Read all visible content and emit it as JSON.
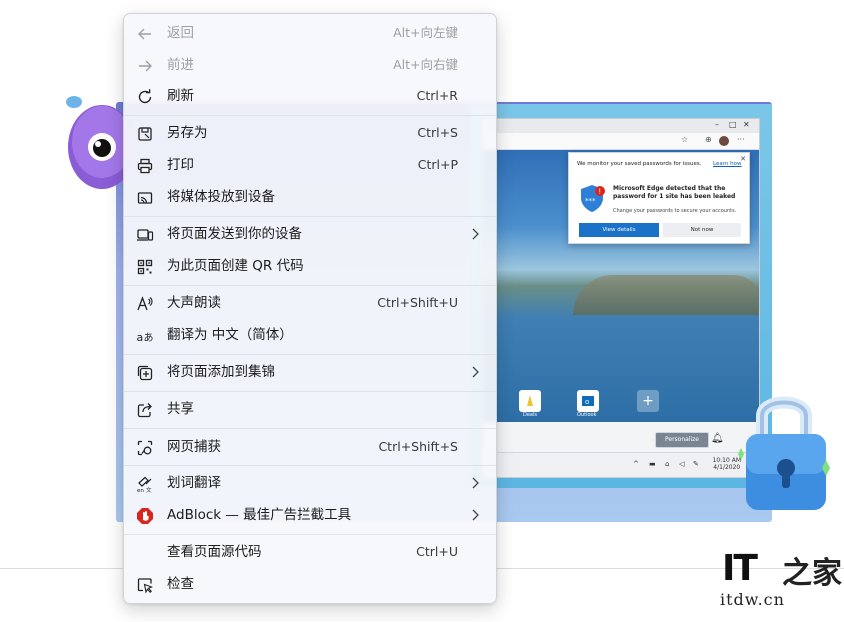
{
  "menu": {
    "back": {
      "label": "返回",
      "shortcut": "Alt+向左键"
    },
    "forward": {
      "label": "前进",
      "shortcut": "Alt+向右键"
    },
    "refresh": {
      "label": "刷新",
      "shortcut": "Ctrl+R"
    },
    "save_as": {
      "label": "另存为",
      "shortcut": "Ctrl+S"
    },
    "print": {
      "label": "打印",
      "shortcut": "Ctrl+P"
    },
    "cast": {
      "label": "将媒体投放到设备"
    },
    "send_to_devices": {
      "label": "将页面发送到你的设备"
    },
    "qr_code": {
      "label": "为此页面创建 QR 代码"
    },
    "read_aloud": {
      "label": "大声朗读",
      "shortcut": "Ctrl+Shift+U"
    },
    "translate": {
      "label": "翻译为 中文（简体）"
    },
    "add_to_collections": {
      "label": "将页面添加到集锦"
    },
    "share": {
      "label": "共享"
    },
    "web_capture": {
      "label": "网页捕获",
      "shortcut": "Ctrl+Shift+S"
    },
    "word_translate": {
      "label": "划词翻译"
    },
    "adblock": {
      "label": "AdBlock — 最佳广告拦截工具"
    },
    "view_source": {
      "label": "查看页面源代码",
      "shortcut": "Ctrl+U"
    },
    "inspect": {
      "label": "检查"
    }
  },
  "background": {
    "password_popup": {
      "monitor_text": "We monitor your saved passwords for issues.",
      "learn_how": "Learn how",
      "headline": "Microsoft Edge detected that the password for 1 site has been leaked",
      "subtext": "Change your passwords to secure your accounts.",
      "view_details": "View details",
      "not_now": "Not now"
    },
    "quick_links": [
      {
        "label": "Deals"
      },
      {
        "label": "Outlook"
      }
    ],
    "personalize": "Personalize",
    "clock_time": "10:10 AM",
    "clock_date": "4/1/2020"
  },
  "watermark": {
    "logo": "IT",
    "cn": "之家",
    "url": "itdw.cn"
  },
  "colors": {
    "adblock_red": "#d7261e",
    "menu_bg": "#f6f8fb",
    "disabled_text": "#9aa0a6"
  }
}
